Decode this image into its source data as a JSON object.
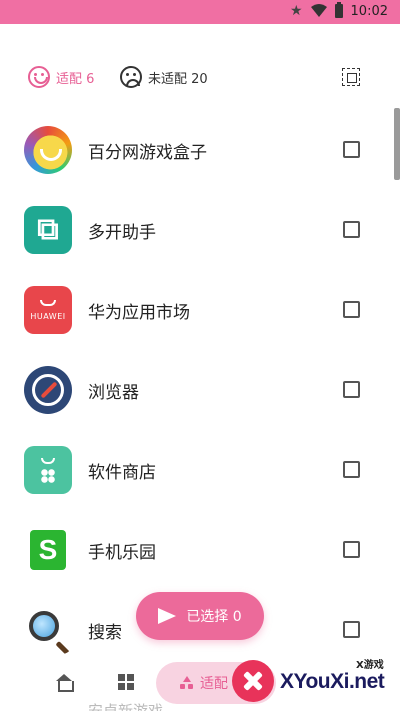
{
  "status_bar": {
    "time": "10:02",
    "icons": [
      "star-icon",
      "wifi-icon",
      "battery-icon"
    ],
    "color": "#f06fa3"
  },
  "filter": {
    "adapted_label": "适配",
    "adapted_count": "6",
    "unadapted_label": "未适配",
    "unadapted_count": "20",
    "accent_color": "#e75f94"
  },
  "apps": [
    {
      "name": "百分网游戏盒子",
      "icon": "baifen-icon",
      "checked": false
    },
    {
      "name": "多开助手",
      "icon": "duokai-icon",
      "checked": false
    },
    {
      "name": "华为应用市场",
      "icon": "huawei-appgallery-icon",
      "icon_text": "HUAWEI",
      "checked": false
    },
    {
      "name": "浏览器",
      "icon": "browser-compass-icon",
      "checked": false
    },
    {
      "name": "软件商店",
      "icon": "software-store-icon",
      "checked": false
    },
    {
      "name": "手机乐园",
      "icon": "shouji-leyuan-icon",
      "icon_text": "S",
      "checked": false
    },
    {
      "name": "搜索",
      "icon": "search-magnifier-icon",
      "checked": false
    }
  ],
  "fab": {
    "label": "已选择 0",
    "icon": "send-icon"
  },
  "bottom_nav": {
    "items": [
      {
        "icon": "home-icon"
      },
      {
        "icon": "grid-icon"
      },
      {
        "icon": "shapes-icon",
        "label": "适配",
        "active": true
      }
    ]
  },
  "partial_row_text": "安卓新游戏",
  "watermark": {
    "small_text": "X游戏",
    "text": "XYouXi.net"
  }
}
